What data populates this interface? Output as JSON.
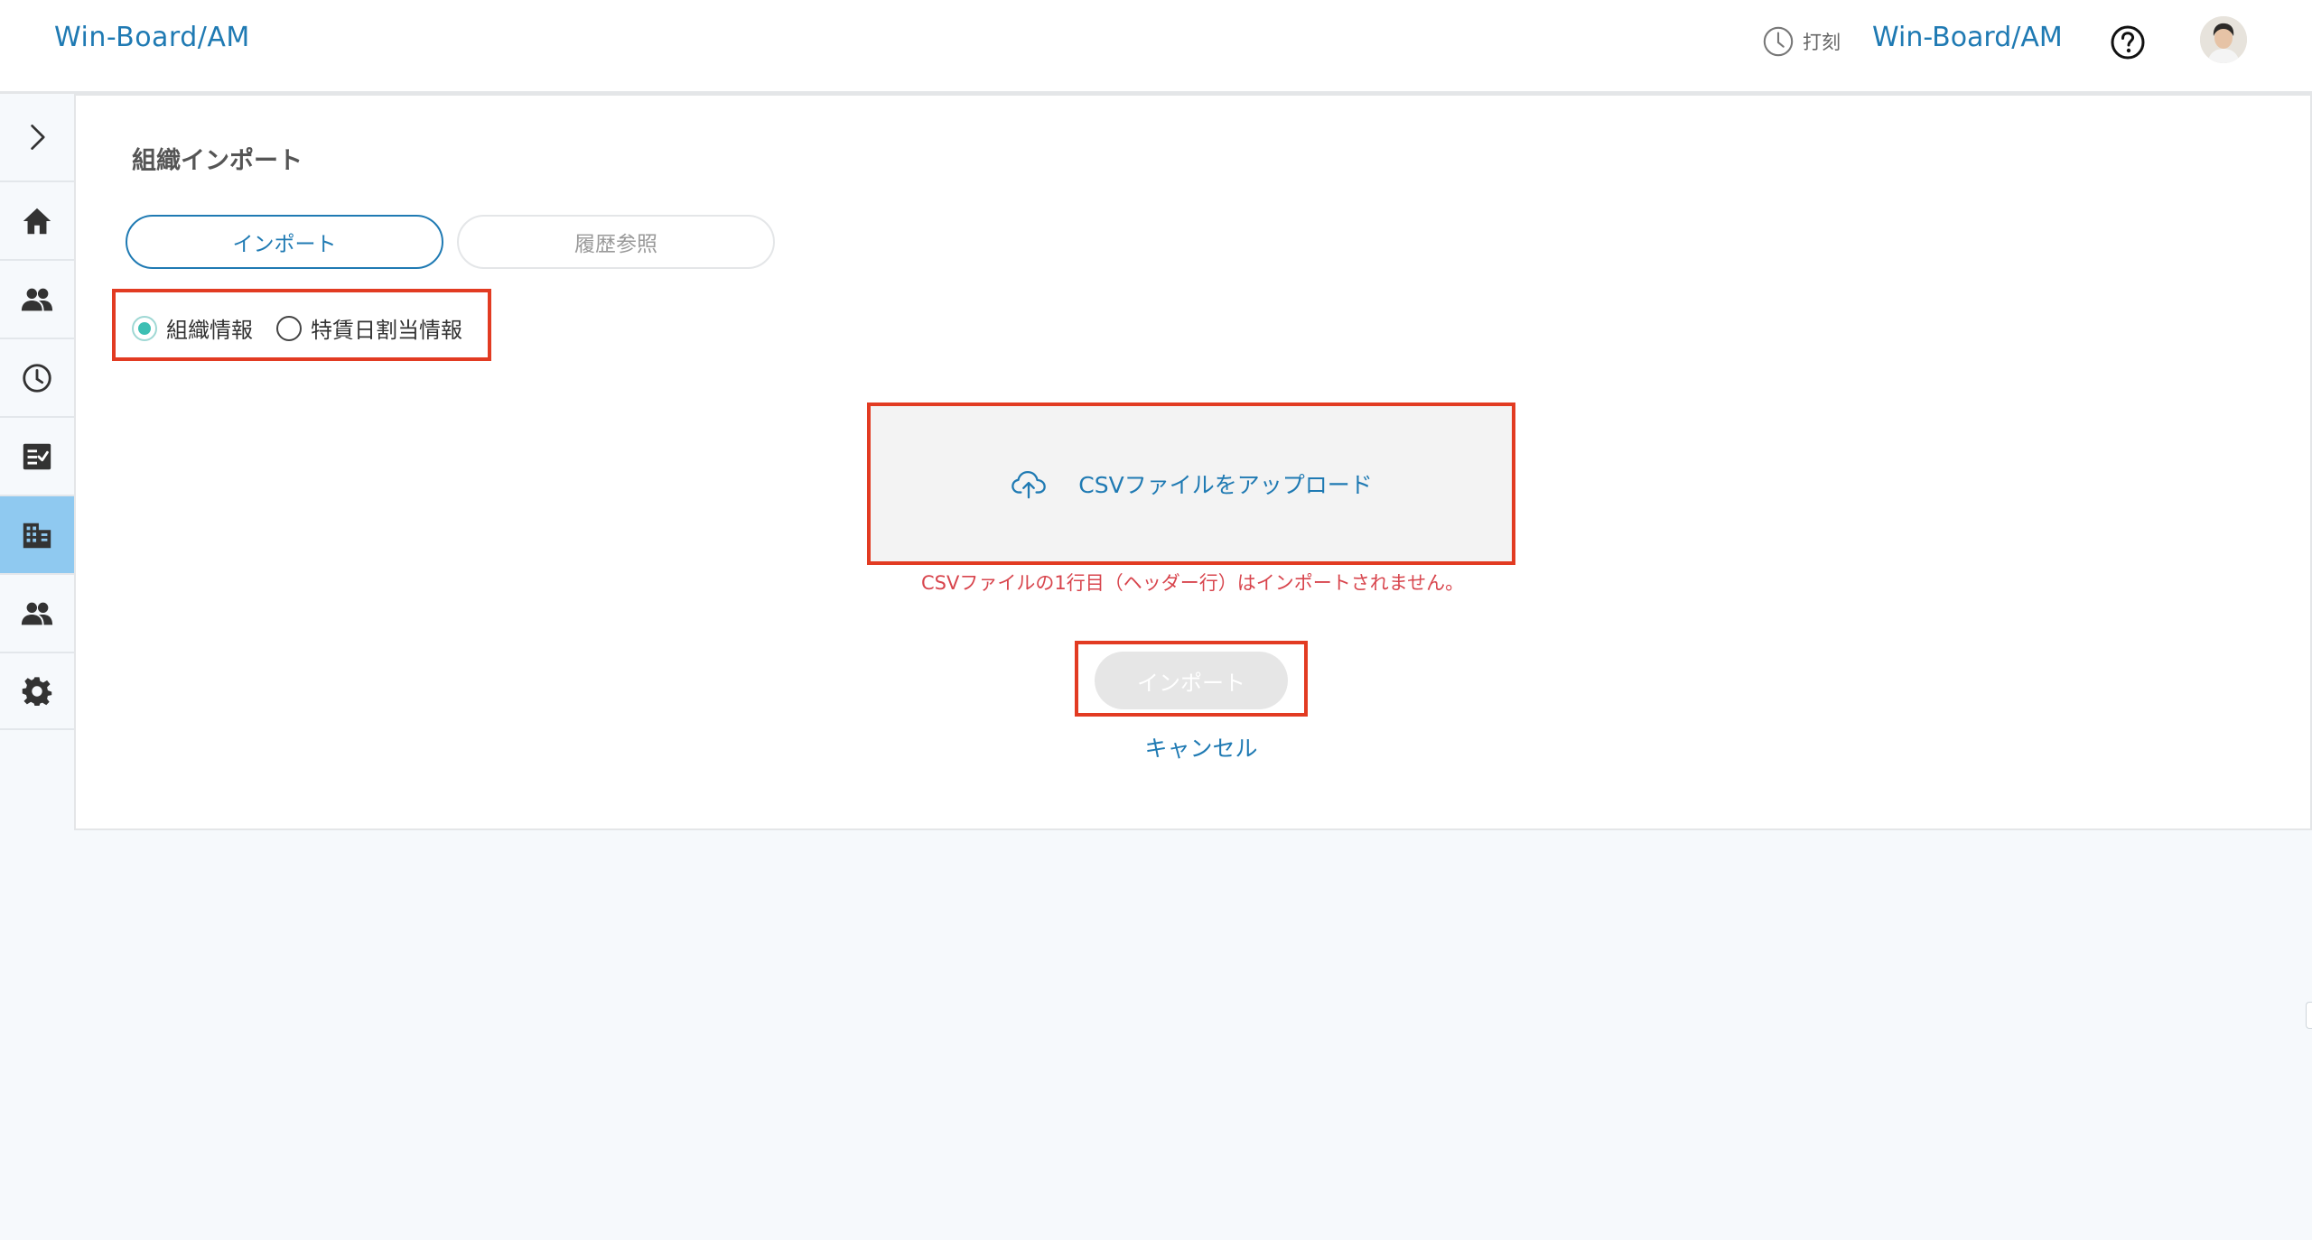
{
  "header": {
    "brand": "Win-Board/AM",
    "clock_label": "打刻",
    "brand_right": "Win-Board/AM"
  },
  "sidebar": {
    "items": [
      {
        "icon": "home-icon"
      },
      {
        "icon": "people-icon"
      },
      {
        "icon": "clock-icon"
      },
      {
        "icon": "checklist-icon"
      },
      {
        "icon": "building-icon",
        "active": true
      },
      {
        "icon": "people-icon"
      },
      {
        "icon": "gear-icon"
      }
    ]
  },
  "main": {
    "title": "組織インポート",
    "tabs": [
      {
        "label": "インポート",
        "active": true
      },
      {
        "label": "履歴参照",
        "active": false
      }
    ],
    "radios": [
      {
        "label": "組織情報",
        "checked": true
      },
      {
        "label": "特賃日割当情報",
        "checked": false
      }
    ],
    "upload_label": "CSVファイルをアップロード",
    "warning": "CSVファイルの1行目（ヘッダー行）はインポートされません。",
    "import_button": "インポート",
    "cancel": "キャンセル"
  },
  "colors": {
    "accent": "#1f7ab3",
    "highlight_border": "#e23b22",
    "active_sidebar": "#8fc9f0",
    "warning": "#d8454d",
    "radio_checked": "#3cbfb3"
  }
}
